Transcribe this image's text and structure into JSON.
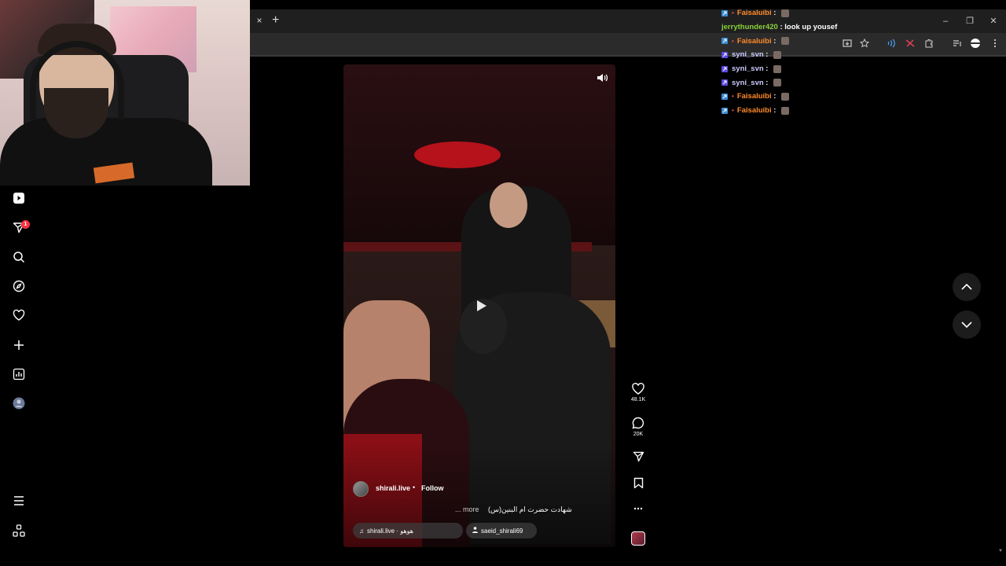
{
  "browser": {
    "tab_close": "×",
    "new_tab": "+",
    "window": {
      "minimize": "–",
      "restore": "❐",
      "close": "✕"
    }
  },
  "sidebar": {
    "items": [
      {
        "icon": "reels-icon"
      },
      {
        "icon": "send-icon",
        "badge": "1"
      },
      {
        "icon": "search-icon"
      },
      {
        "icon": "explore-icon"
      },
      {
        "icon": "heart-icon"
      },
      {
        "icon": "create-icon"
      },
      {
        "icon": "dashboard-icon"
      },
      {
        "icon": "profile-avatar"
      }
    ],
    "bottom": [
      {
        "icon": "menu-icon"
      },
      {
        "icon": "also-from-meta-icon"
      }
    ]
  },
  "reel": {
    "username": "shirali.live",
    "dot": "•",
    "follow_label": "Follow",
    "caption": "شهادت حضرت ام البنین(س)",
    "more_label": "... more",
    "audio": "shirali.live · هوهو",
    "tagged_user": "saeid_shirali69"
  },
  "actions": {
    "likes": "48.1K",
    "comments": "20K"
  },
  "chat": {
    "messages": [
      {
        "user": "Faisaluibi",
        "color": "#ff8a2a",
        "text": "",
        "badges": true,
        "emote": true
      },
      {
        "user": "jerrythunder420",
        "color": "#8ad13a",
        "text": "look up yousef",
        "badges": false,
        "emote": false
      },
      {
        "user": "Faisaluibi",
        "color": "#ff8a2a",
        "text": "",
        "badges": true,
        "emote": true
      },
      {
        "user": "syni_svn",
        "color": "#c9c9ff",
        "text": "",
        "badges": true,
        "emote": true
      },
      {
        "user": "syni_svn",
        "color": "#c9c9ff",
        "text": "",
        "badges": true,
        "emote": true
      },
      {
        "user": "syni_svn",
        "color": "#c9c9ff",
        "text": "",
        "badges": true,
        "emote": true
      },
      {
        "user": "Faisaluibi",
        "color": "#ff8a2a",
        "text": "",
        "badges": true,
        "emote": true
      },
      {
        "user": "Faisaluibi",
        "color": "#ff8a2a",
        "text": "",
        "badges": true,
        "emote": true
      }
    ]
  },
  "colors": {
    "accent_badge": "#ff3040",
    "page_bg": "#000000",
    "chrome_bg": "#2b2b2b"
  }
}
